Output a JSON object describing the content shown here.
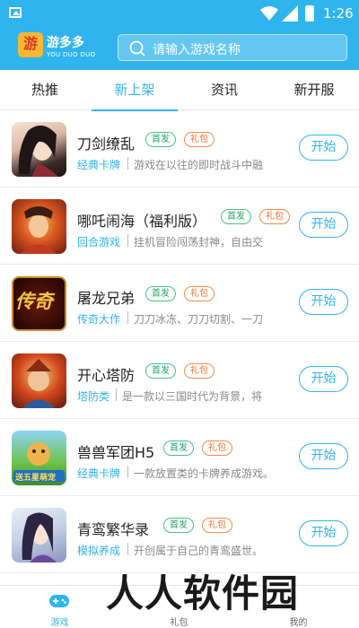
{
  "status": {
    "time": "1:26"
  },
  "header": {
    "logo_glyph": "游",
    "logo_title": "游多多",
    "logo_sub": "YOU DUO DUO",
    "search_placeholder": "请输入游戏名称"
  },
  "tabs": [
    {
      "label": "热推"
    },
    {
      "label": "新上架"
    },
    {
      "label": "资讯"
    },
    {
      "label": "新开服"
    }
  ],
  "games": [
    {
      "name": "刀剑缭乱",
      "tags": [
        "首发",
        "礼包"
      ],
      "category": "经典卡牌",
      "desc": "游戏在以往的即时战斗中融",
      "button": "开始"
    },
    {
      "name": "哪吒闹海（福利版）",
      "tags": [
        "首发",
        "礼包"
      ],
      "category": "回合游戏",
      "desc": "挂机冒险闯荡封神，自由交",
      "button": "开始"
    },
    {
      "name": "屠龙兄弟",
      "tags": [
        "首发",
        "礼包"
      ],
      "category": "传奇大作",
      "desc": "刀刀冰冻、刀刀切割、一刀",
      "button": "开始",
      "icon_text": "传奇"
    },
    {
      "name": "开心塔防",
      "tags": [
        "首发",
        "礼包"
      ],
      "category": "塔防类",
      "desc": "是一款以三国时代为背景，将",
      "button": "开始"
    },
    {
      "name": "兽兽军团H5",
      "tags": [
        "首发",
        "礼包"
      ],
      "category": "经典卡牌",
      "desc": "一款放置类的卡牌养成游戏。",
      "button": "开始",
      "icon_text": "送五星萌宠"
    },
    {
      "name": "青鸾繁华录",
      "tags": [
        "首发",
        "礼包"
      ],
      "category": "模拟养成",
      "desc": "开创属于自己的青鸾盛世。",
      "button": "开始"
    }
  ],
  "bottom_nav": [
    {
      "label": "游戏"
    },
    {
      "label": "礼包"
    },
    {
      "label": "我的"
    }
  ],
  "watermark": "人人软件园",
  "colors": {
    "primary": "#2fb4ee",
    "tag_first": "#1fa467",
    "tag_gift": "#eb6d24"
  }
}
